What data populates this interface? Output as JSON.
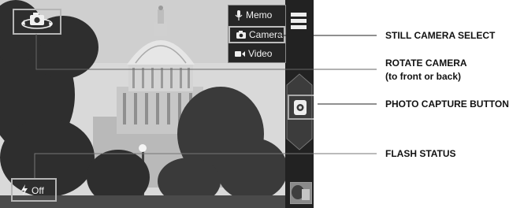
{
  "camera_ui": {
    "modes": [
      {
        "label": "Memo",
        "icon": "microphone-icon"
      },
      {
        "label": "Camera",
        "icon": "camera-icon"
      },
      {
        "label": "Video",
        "icon": "video-icon"
      }
    ],
    "selected_mode": "Camera",
    "flash_label": "Off",
    "icons": [
      "rotate-camera-icon",
      "menu-icon",
      "capture-icon",
      "flash-icon",
      "gallery-thumbnail"
    ]
  },
  "callouts": {
    "still_camera_select": "STILL CAMERA SELECT",
    "rotate_camera": "ROTATE CAMERA",
    "rotate_camera_sub": "(to front or back)",
    "photo_capture_button": "PHOTO CAPTURE BUTTON",
    "flash_status": "FLASH STATUS"
  }
}
